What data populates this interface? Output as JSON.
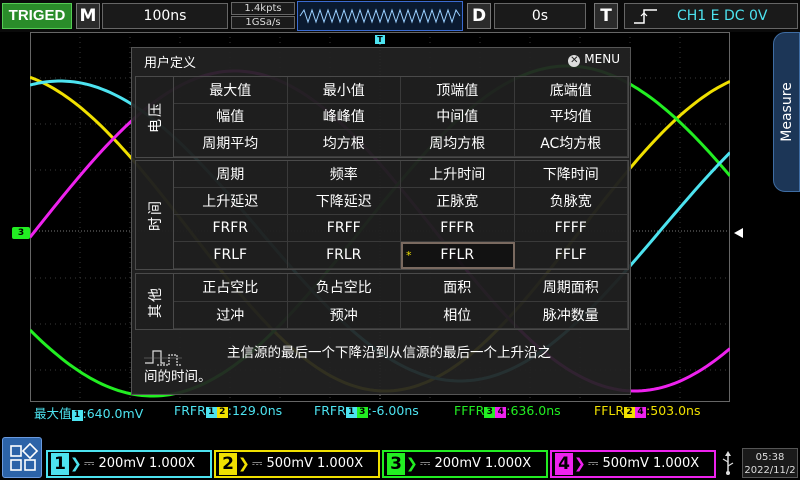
{
  "topbar": {
    "trig_status": "TRIGED",
    "m_key": "M",
    "timebase": "100ns",
    "mem_depth": "1.4kpts",
    "sample_rate": "1GSa/s",
    "d_key": "D",
    "delay": "0s",
    "t_key": "T",
    "trigger_setting": "CH1 E DC 0V"
  },
  "side_tab": {
    "label": "Measure"
  },
  "dialog": {
    "title": "用户定义",
    "menu_label": "MENU",
    "sections": [
      {
        "label": "电压",
        "items": [
          "最大值",
          "最小值",
          "顶端值",
          "底端值",
          "幅值",
          "峰峰值",
          "中间值",
          "平均值",
          "周期平均",
          "均方根",
          "周均方根",
          "AC均方根"
        ]
      },
      {
        "label": "时间",
        "items": [
          "周期",
          "频率",
          "上升时间",
          "下降时间",
          "上升延迟",
          "下降延迟",
          "正脉宽",
          "负脉宽",
          "FRFR",
          "FRFF",
          "FFFR",
          "FFFF",
          "FRLF",
          "FRLR",
          "FFLR",
          "FFLF"
        ]
      },
      {
        "label": "其他",
        "items": [
          "正占空比",
          "负占空比",
          "面积",
          "周期面积",
          "过冲",
          "预冲",
          "相位",
          "脉冲数量"
        ]
      }
    ],
    "selected_item": "FFLR",
    "description_line1": "主信源的最后一个下降沿到从信源的最后一个上升沿之",
    "description_line2": "间的时间。"
  },
  "measurements": [
    {
      "name": "最大值",
      "src1": "1",
      "value": ":640.0mV",
      "color": "#4de3f0"
    },
    {
      "name": "FRFR",
      "src1": "1",
      "src2": "2",
      "value": ":129.0ns",
      "color": "#4de3f0"
    },
    {
      "name": "FRFR",
      "src1": "1",
      "src2": "3",
      "value": ":-6.00ns",
      "color": "#4de3f0"
    },
    {
      "name": "FFFR",
      "src1": "3",
      "src2": "4",
      "value": ":636.0ns",
      "color": "#22ee22"
    },
    {
      "name": "FFLR",
      "src1": "2",
      "src2": "4",
      "value": ":503.0ns",
      "color": "#f0e000"
    }
  ],
  "channels": [
    {
      "num": "1",
      "setting": "200mV 1.000X",
      "color": "#4de3f0"
    },
    {
      "num": "2",
      "setting": "500mV 1.000X",
      "color": "#f0e000"
    },
    {
      "num": "3",
      "setting": "200mV 1.000X",
      "color": "#22ee22"
    },
    {
      "num": "4",
      "setting": "500mV 1.000X",
      "color": "#ee22ee"
    }
  ],
  "clock": {
    "time": "05:38",
    "date": "2022/11/2"
  },
  "markers": {
    "ch3_level": "3",
    "trigger_pos": "T"
  }
}
